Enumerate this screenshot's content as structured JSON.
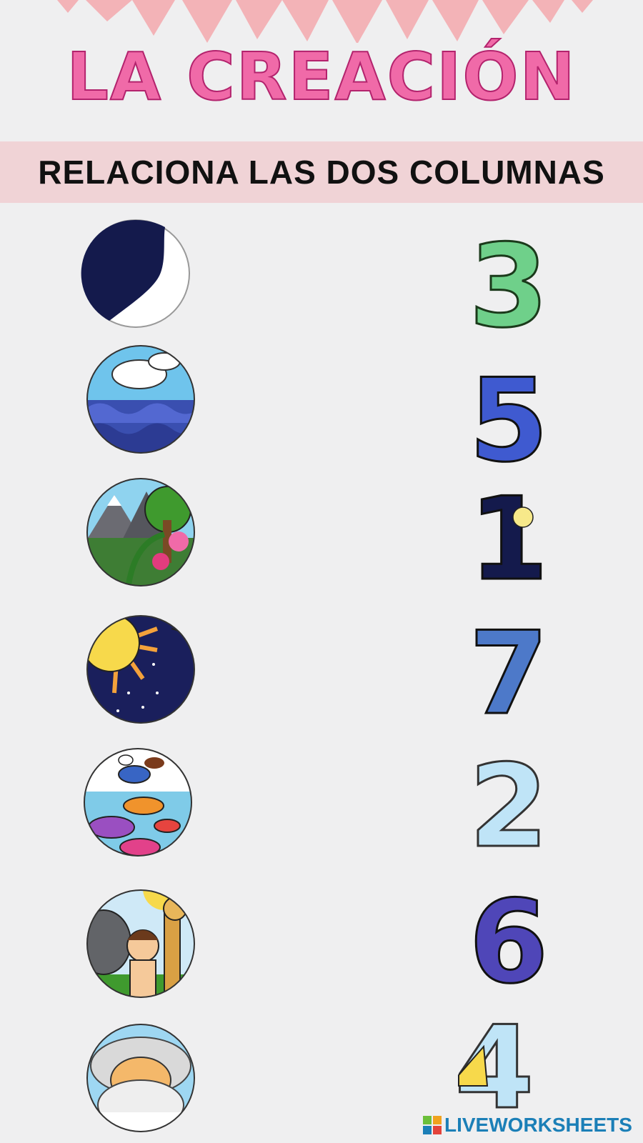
{
  "title": "LA CREACIÓN",
  "banner": "RELACIONA LAS DOS COLUMNAS",
  "numbers": [
    "3",
    "5",
    "1",
    "7",
    "2",
    "6",
    "4"
  ],
  "brand": "LIVEWORKSHEETS",
  "colors": {
    "title": "#f06aa8",
    "banner_bg": "#f0d3d6",
    "background": "#efeff0",
    "brand": "#1b7fb7"
  }
}
